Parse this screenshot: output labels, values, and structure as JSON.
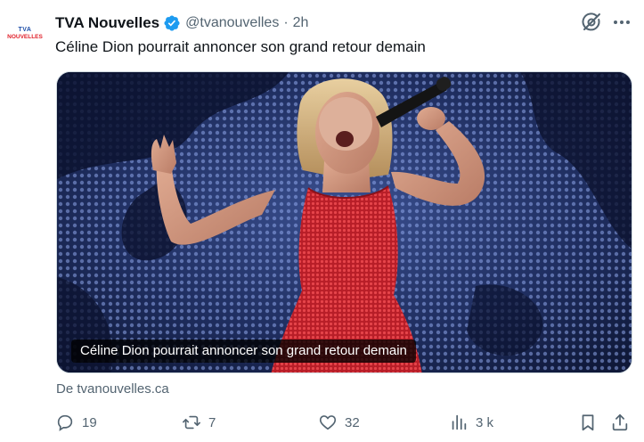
{
  "tweet": {
    "author_name": "TVA Nouvelles",
    "handle": "@tvanouvelles",
    "separator": "·",
    "time": "2h",
    "text": "Céline Dion pourrait annoncer son grand retour demain",
    "avatar_logo_top": "TVA",
    "avatar_logo_bottom": "NOUVELLES"
  },
  "card": {
    "caption": "Céline Dion pourrait annoncer son grand retour demain",
    "source": "De tvanouvelles.ca"
  },
  "actions": {
    "replies": "19",
    "reposts": "7",
    "likes": "32",
    "views": "3 k"
  },
  "icons": {
    "verified": "verified-badge-icon",
    "grok": "grok-icon",
    "more": "more-icon",
    "reply": "reply-icon",
    "repost": "repost-icon",
    "like": "like-icon",
    "views": "views-icon",
    "bookmark": "bookmark-icon",
    "share": "share-icon"
  },
  "colors": {
    "text_primary": "#0f1419",
    "text_secondary": "#536471",
    "verified_blue": "#1d9bf0",
    "dress_red": "#c8232c",
    "stage_blue": "#1b2a55"
  }
}
